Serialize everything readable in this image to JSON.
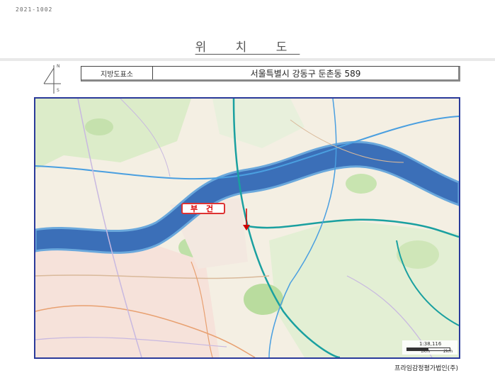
{
  "header": {
    "page_id": "2021-1002",
    "title": "위 치 도"
  },
  "north_arrow": {
    "n": "N",
    "s": "S"
  },
  "address_row": {
    "label": "지방도표소",
    "value": "서울특별시 강동구 둔촌동 589"
  },
  "map": {
    "target_label": "부 건",
    "scale_ratio": "1:38,116",
    "scale_mark_1": "1km",
    "scale_mark_2": "2km",
    "colors": {
      "river": "#3b6fb8",
      "river_edge": "#5aa0d8",
      "park": "#bfe0a8",
      "urban": "#f3e6dc",
      "road_blue": "#4a9fe0",
      "road_teal": "#1aa0a0",
      "marker": "#d00000"
    }
  },
  "footer": {
    "company": "프라임감정평가법인(주)"
  }
}
